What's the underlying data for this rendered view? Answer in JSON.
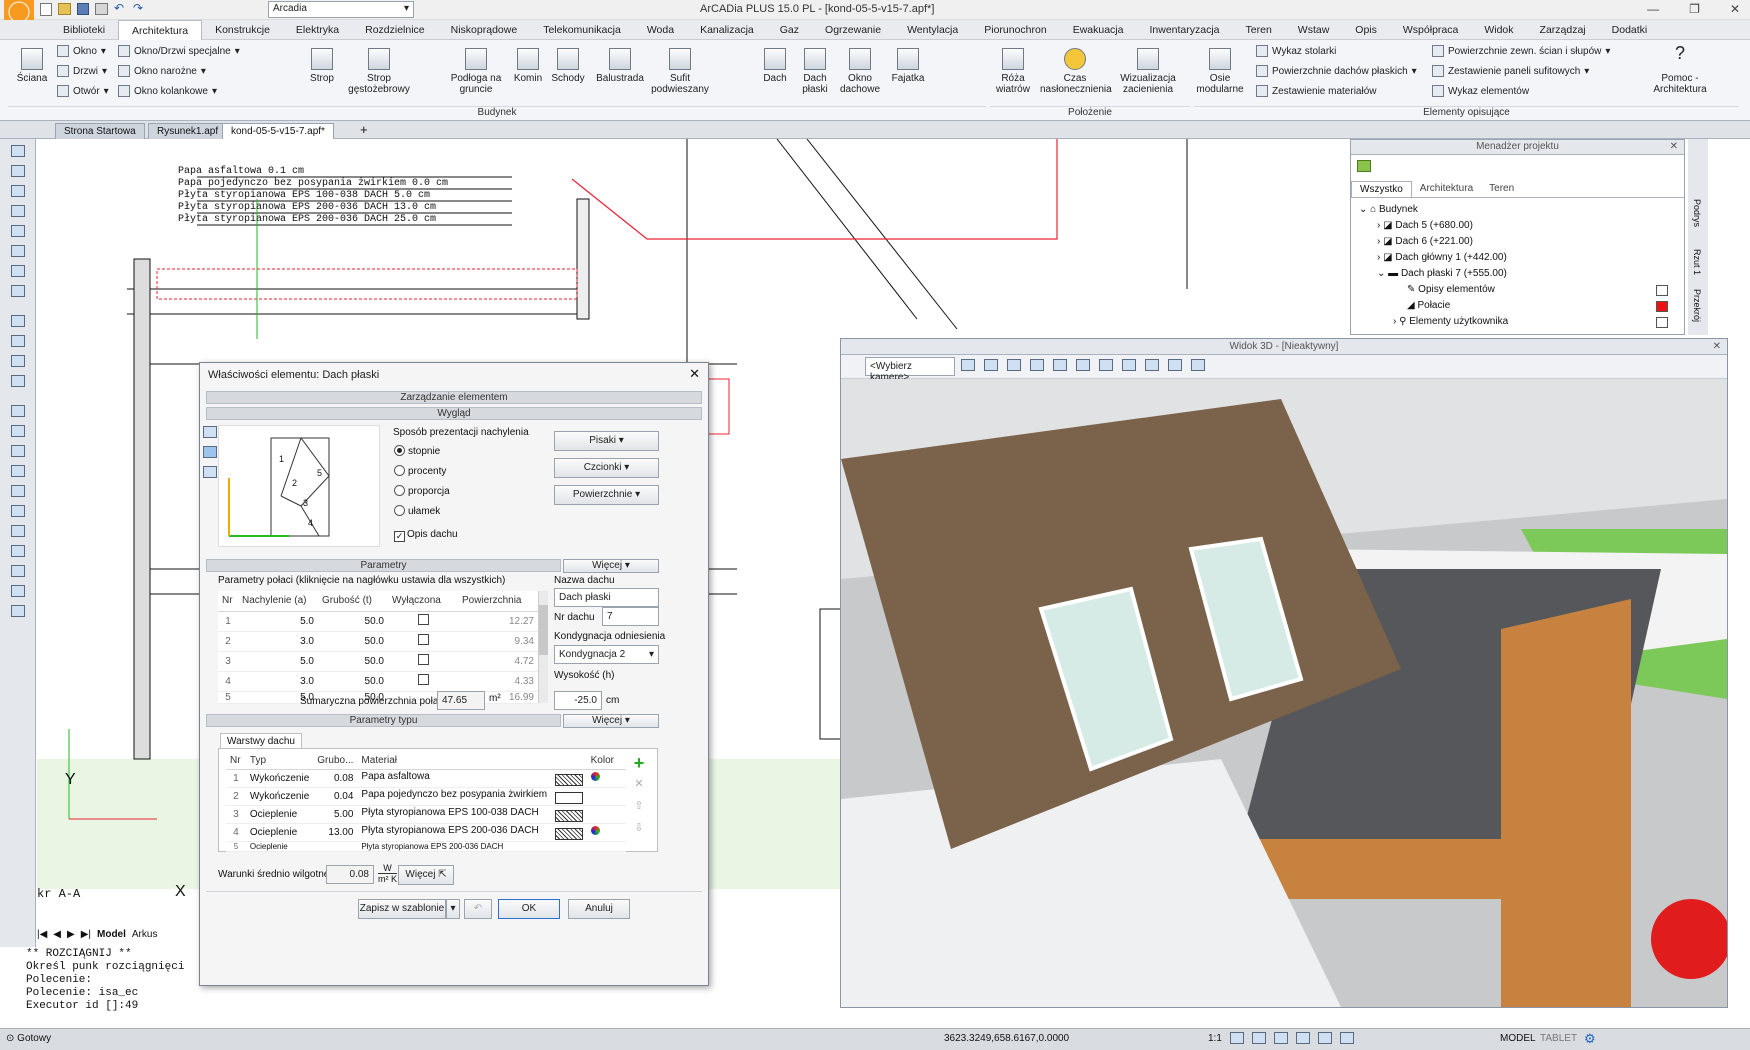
{
  "app": {
    "title": "ArCADia PLUS 15.0 PL - [kond-05-5-v15-7.apf*]",
    "profile_combo": "Arcadia"
  },
  "menu": [
    "Biblioteki",
    "Architektura",
    "Konstrukcje",
    "Elektryka",
    "Rozdzielnice",
    "Niskoprądowe",
    "Telekomunikacja",
    "Woda",
    "Kanalizacja",
    "Gaz",
    "Ogrzewanie",
    "Wentylacja",
    "Piorunochron",
    "Ewakuacja",
    "Inwentaryzacja",
    "Teren",
    "Wstaw",
    "Opis",
    "Współpraca",
    "Widok",
    "Zarządzaj",
    "Dodatki"
  ],
  "ribbon": {
    "sciana": "Ściana",
    "okno": "Okno",
    "drzwi": "Drzwi",
    "otwor": "Otwór",
    "okno_drzwi": "Okno/Drzwi specjalne",
    "okno_narozne": "Okno narożne",
    "okno_kolankowe": "Okno kolankowe",
    "strop": "Strop",
    "strop_gesto": "Strop gęstożebrowy",
    "podloga": "Podłoga na gruncie",
    "komin": "Komin",
    "schody": "Schody",
    "balustrada": "Balustrada",
    "sufit": "Sufit podwieszany",
    "dach": "Dach",
    "dach_plaski": "Dach płaski",
    "okno_dachowe": "Okno dachowe",
    "fajatka": "Fajatka",
    "roza": "Róża wiatrów",
    "czas": "Czas nasłonecznienia",
    "wizualizacja": "Wizualizacja zacienienia",
    "osie": "Osie modularne",
    "wykaz_stolarki": "Wykaz stolarki",
    "pow_dachow": "Powierzchnie dachów płaskich",
    "zest_mat": "Zestawienie materiałów",
    "pow_zewn": "Powierzchnie zewn. ścian i słupów",
    "zest_paneli": "Zestawienie paneli sufitowych",
    "wykaz_elem": "Wykaz elementów",
    "pomoc": "Pomoc - Architektura",
    "group_budynek": "Budynek",
    "group_polozenie": "Położenie",
    "group_elementy": "Elementy opisujące"
  },
  "doc_tabs": [
    "Strona Startowa",
    "Rysunek1.apf",
    "kond-05-5-v15-7.apf*"
  ],
  "drawing_labels": [
    "Papa asfaltowa 0.1 cm",
    "Papa pojedynczo bez posypania żwirkiem 0.0 cm",
    "Płyta styropianowa EPS 100-038 DACH 5.0 cm",
    "Płyta styropianowa EPS 200-036 DACH 13.0 cm",
    "Płyta styropianowa EPS 200-036 DACH 25.0 cm"
  ],
  "axis": {
    "y": "Y",
    "x": "X",
    "section": "kr A-A"
  },
  "layout_tabs": {
    "model": "Model",
    "arkusz": "Arkus"
  },
  "command_lines": [
    "** ROZCIĄGNIJ **",
    "Określ punk rozciągnięci",
    "Polecenie:",
    "Polecenie: isa_ec",
    "Executor id []:49"
  ],
  "status": {
    "left": "Gotowy",
    "coords": "3623.3249,658.6167,0.0000",
    "scale": "1:1",
    "model": "MODEL",
    "tablet": "TABLET"
  },
  "dialog": {
    "title": "Właściwości elementu: Dach płaski",
    "sec_zarz": "Zarządzanie elementem",
    "sec_wyglad": "Wygląd",
    "nachylenie_label": "Sposób prezentacji nachylenia",
    "opt_stopnie": "stopnie",
    "opt_procenty": "procenty",
    "opt_proporcja": "proporcja",
    "opt_ulamek": "ułamek",
    "opis_dachu": "Opis dachu",
    "btn_pisaki": "Pisaki",
    "btn_czcionki": "Czcionki",
    "btn_powierzchnie": "Powierzchnie",
    "sec_parametry": "Parametry",
    "wiecej": "Więcej",
    "params_hint": "Parametry połaci (kliknięcie na nagłówku ustawia dla wszystkich)",
    "cols": [
      "Nr",
      "Nachylenie (a)",
      "Grubość (t)",
      "Wyłączona",
      "Powierzchnia"
    ],
    "rows": [
      {
        "nr": "1",
        "nach": "5.0",
        "grub": "50.0",
        "pow": "12.27"
      },
      {
        "nr": "2",
        "nach": "3.0",
        "grub": "50.0",
        "pow": "9.34"
      },
      {
        "nr": "3",
        "nach": "5.0",
        "grub": "50.0",
        "pow": "4.72"
      },
      {
        "nr": "4",
        "nach": "3.0",
        "grub": "50.0",
        "pow": "4.33"
      },
      {
        "nr": "5",
        "nach": "5.0",
        "grub": "50.0",
        "pow": "16.99"
      }
    ],
    "nazwa_label": "Nazwa dachu",
    "nazwa_value": "Dach płaski",
    "nr_label": "Nr dachu",
    "nr_value": "7",
    "kond_label": "Kondygnacja odniesienia",
    "kond_value": "Kondygnacja 2",
    "wys_label": "Wysokość (h)",
    "wys_value": "-25.0",
    "wys_unit": "cm",
    "suma_label": "Sumaryczna powierzchnia połaci:",
    "suma_value": "47.65",
    "suma_unit": "m²",
    "sec_typ": "Parametry typu",
    "warstwy_tab": "Warstwy dachu",
    "layer_cols": [
      "Nr",
      "Typ",
      "Grubo...",
      "Materiał",
      "Kolor"
    ],
    "layers": [
      {
        "nr": "1",
        "typ": "Wykończenie",
        "grub": "0.08",
        "mat": "Papa asfaltowa"
      },
      {
        "nr": "2",
        "typ": "Wykończenie",
        "grub": "0.04",
        "mat": "Papa pojedynczo bez posypania żwirkiem"
      },
      {
        "nr": "3",
        "typ": "Ocieplenie",
        "grub": "5.00",
        "mat": "Płyta styropianowa EPS 100-038 DACH"
      },
      {
        "nr": "4",
        "typ": "Ocieplenie",
        "grub": "13.00",
        "mat": "Płyta styropianowa EPS 200-036 DACH"
      },
      {
        "nr": "5",
        "typ": "Ocieplenie",
        "grub": "",
        "mat": "Płyta styropianowa EPS 200-036 DACH"
      }
    ],
    "u_label": "Warunki średnio wilgotne U =",
    "u_value": "0.08",
    "u_unit_top": "W",
    "u_unit_bottom": "m² K",
    "btn_wiecej": "Więcej",
    "btn_zapisz": "Zapisz w szablonie",
    "btn_ok": "OK",
    "btn_anuluj": "Anuluj",
    "preview_nums": [
      "1",
      "2",
      "3",
      "4",
      "5"
    ]
  },
  "project_manager": {
    "title": "Menadżer projektu",
    "tabs": [
      "Wszystko",
      "Architektura",
      "Teren"
    ],
    "items": [
      {
        "label": "Budynek",
        "level": 0
      },
      {
        "label": "Dach 5 (+680.00)",
        "level": 1
      },
      {
        "label": "Dach 6 (+221.00)",
        "level": 1
      },
      {
        "label": "Dach główny 1 (+442.00)",
        "level": 1
      },
      {
        "label": "Dach płaski 7 (+555.00)",
        "level": 1
      },
      {
        "label": "Opisy elementów",
        "level": 2
      },
      {
        "label": "Połacie",
        "level": 2
      },
      {
        "label": "Elementy użytkownika",
        "level": 1
      }
    ],
    "side_tabs": [
      "Podrys",
      "Rzut 1",
      "Przekrój"
    ]
  },
  "view3d": {
    "title": "Widok 3D - [Nieaktywny]",
    "camera": "<Wybierz kamerę>"
  }
}
